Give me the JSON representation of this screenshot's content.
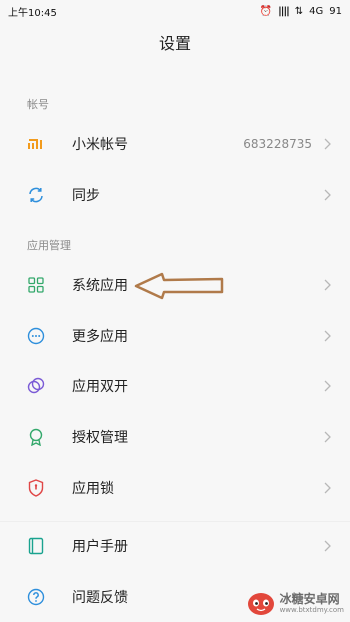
{
  "status_bar": {
    "time": "上午10:45",
    "network": "4G",
    "battery": "91"
  },
  "page": {
    "title": "设置"
  },
  "sections": [
    {
      "label": "帐号"
    },
    {
      "label": "应用管理"
    }
  ],
  "rows": [
    {
      "label": "小米帐号",
      "value": "683228735",
      "icon": "mi-logo-icon",
      "color": "#f29b1d"
    },
    {
      "label": "同步",
      "icon": "sync-icon",
      "color": "#2e8fdc"
    },
    {
      "label": "系统应用",
      "icon": "grid-apps-icon",
      "color": "#33a86b"
    },
    {
      "label": "更多应用",
      "icon": "more-dots-icon",
      "color": "#2e8fdc"
    },
    {
      "label": "应用双开",
      "icon": "dual-circles-icon",
      "color": "#7b5bd6"
    },
    {
      "label": "授权管理",
      "icon": "badge-icon",
      "color": "#33a86b"
    },
    {
      "label": "应用锁",
      "icon": "shield-lock-icon",
      "color": "#e04646"
    },
    {
      "label": "用户手册",
      "icon": "manual-icon",
      "color": "#1aa38f"
    },
    {
      "label": "问题反馈",
      "icon": "question-icon",
      "color": "#2e8fdc"
    }
  ],
  "annotation": {
    "arrow_color": "#b07a4a"
  },
  "watermark": {
    "text": "冰糖安卓网",
    "url": "www.btxtdmy.com"
  }
}
